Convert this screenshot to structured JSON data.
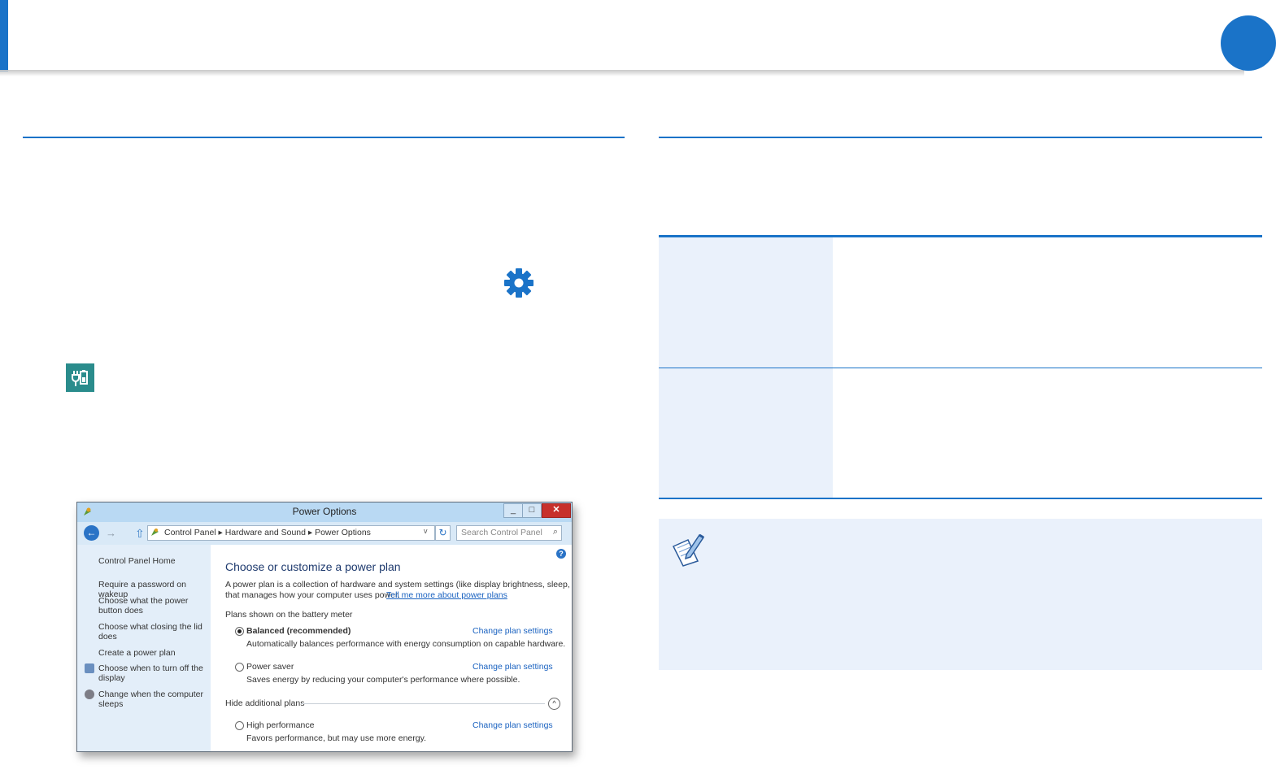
{
  "window": {
    "title": "Power Options",
    "minimize_label": "_",
    "maximize_label": "□",
    "close_label": "✕",
    "breadcrumb": "Control Panel  ▸  Hardware and Sound  ▸  Power Options",
    "address_prefix": "▸",
    "search_placeholder": "Search Control Panel",
    "back_glyph": "←",
    "forward_glyph": "→",
    "up_glyph": "⇧",
    "refresh_glyph": "↻",
    "dropdown_glyph": "v",
    "search_glyph": "⌕",
    "help_glyph": "?",
    "sidebar": {
      "home": "Control Panel Home",
      "items": [
        "Require a password on wakeup",
        "Choose what the power button does",
        "Choose what closing the lid does",
        "Create a power plan",
        "Choose when to turn off the display",
        "Change when the computer sleeps"
      ]
    },
    "main": {
      "heading": "Choose or customize a power plan",
      "intro_line1": "A power plan is a collection of hardware and system settings (like display brightness, sleep, etc.)",
      "intro_line2": "that manages how your computer uses power.",
      "intro_link": "Tell me more about power plans",
      "plans_caption": "Plans shown on the battery meter",
      "plans": [
        {
          "name": "Balanced (recommended)",
          "selected": true,
          "description": "Automatically balances performance with energy consumption on capable hardware.",
          "link": "Change plan settings"
        },
        {
          "name": "Power saver",
          "selected": false,
          "description": "Saves energy by reducing your computer's performance where possible.",
          "link": "Change plan settings"
        }
      ],
      "hide_plans": "Hide additional plans",
      "collapse_glyph": "^",
      "extra_plan": {
        "name": "High performance",
        "selected": false,
        "description": "Favors performance, but may use more energy.",
        "link": "Change plan settings"
      }
    }
  },
  "colors": {
    "accent": "#1a73c8",
    "table_fill": "#eaf1fb",
    "power_icon": "#2a8c8c",
    "close_button": "#c7302b"
  },
  "icons": [
    "settings-gear-icon",
    "power-options-icon",
    "note-pencil-icon"
  ]
}
